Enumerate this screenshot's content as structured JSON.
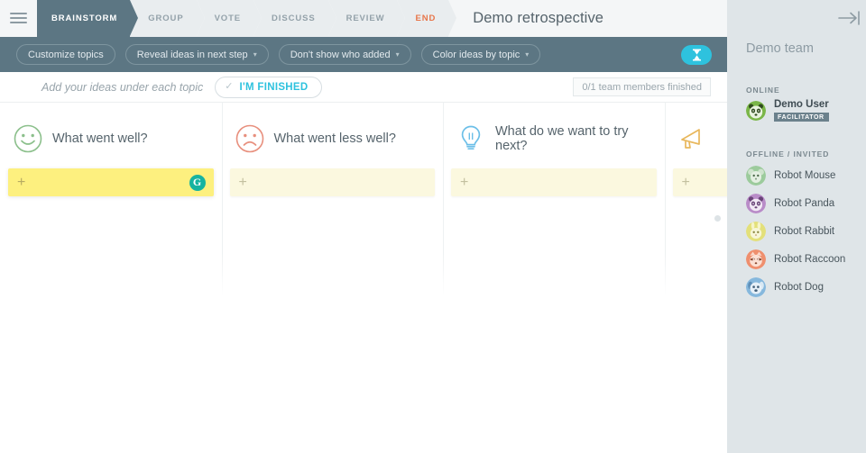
{
  "header": {
    "menu_icon": "hamburger-icon",
    "board_title": "Demo retrospective",
    "stages": [
      {
        "label": "BRAINSTORM",
        "active": true
      },
      {
        "label": "GROUP",
        "active": false
      },
      {
        "label": "VOTE",
        "active": false
      },
      {
        "label": "DISCUSS",
        "active": false
      },
      {
        "label": "REVIEW",
        "active": false
      },
      {
        "label": "END",
        "active": false
      }
    ]
  },
  "toolbar": {
    "buttons": [
      {
        "label": "Customize topics",
        "caret": ""
      },
      {
        "label": "Reveal ideas in next step",
        "caret": "▾"
      },
      {
        "label": "Don't show who added",
        "caret": "▾"
      },
      {
        "label": "Color ideas by topic",
        "caret": "▾"
      }
    ],
    "timer_icon": "hourglass-icon",
    "timer_color": "#2ec2de"
  },
  "status": {
    "hint": "Add your ideas under each topic",
    "finished_tick": "✓",
    "finished_label": "I'M FINISHED",
    "finished_color": "#2ec2de",
    "counter": "0/1 team members finished"
  },
  "board": {
    "columns": [
      {
        "title": "What went well?",
        "icon": "happy-face-icon",
        "icon_color": "#8cc08c",
        "add_plus": "+",
        "highlighted": true,
        "sync_icon": "refresh-icon",
        "sync_label": "G"
      },
      {
        "title": "What went less well?",
        "icon": "sad-face-icon",
        "icon_color": "#e8907e",
        "add_plus": "+",
        "highlighted": false
      },
      {
        "title": "What do we want to try next?",
        "icon": "lightbulb-icon",
        "icon_color": "#6cbfe8",
        "add_plus": "+",
        "highlighted": false
      },
      {
        "title": "",
        "icon": "megaphone-icon",
        "icon_color": "#e8b75c",
        "add_plus": "+",
        "highlighted": false
      }
    ]
  },
  "panel": {
    "collapse_icon": "arrow-right-icon",
    "team_title": "Demo team",
    "online_label": "ONLINE",
    "offline_label": "OFFLINE / INVITED",
    "online_members": [
      {
        "name": "Demo User",
        "badge": "FACILITATOR",
        "avatar": "panda-avatar",
        "avatar_color": "#7ab648"
      }
    ],
    "offline_members": [
      {
        "name": "Robot Mouse",
        "avatar": "mouse-avatar",
        "avatar_color": "#9ccb9c"
      },
      {
        "name": "Robot Panda",
        "avatar": "panda-avatar",
        "avatar_color": "#b98cc8"
      },
      {
        "name": "Robot Rabbit",
        "avatar": "rabbit-avatar",
        "avatar_color": "#e3e07a"
      },
      {
        "name": "Robot Raccoon",
        "avatar": "raccoon-avatar",
        "avatar_color": "#ef8f6e"
      },
      {
        "name": "Robot Dog",
        "avatar": "dog-avatar",
        "avatar_color": "#86b8dd"
      }
    ]
  }
}
